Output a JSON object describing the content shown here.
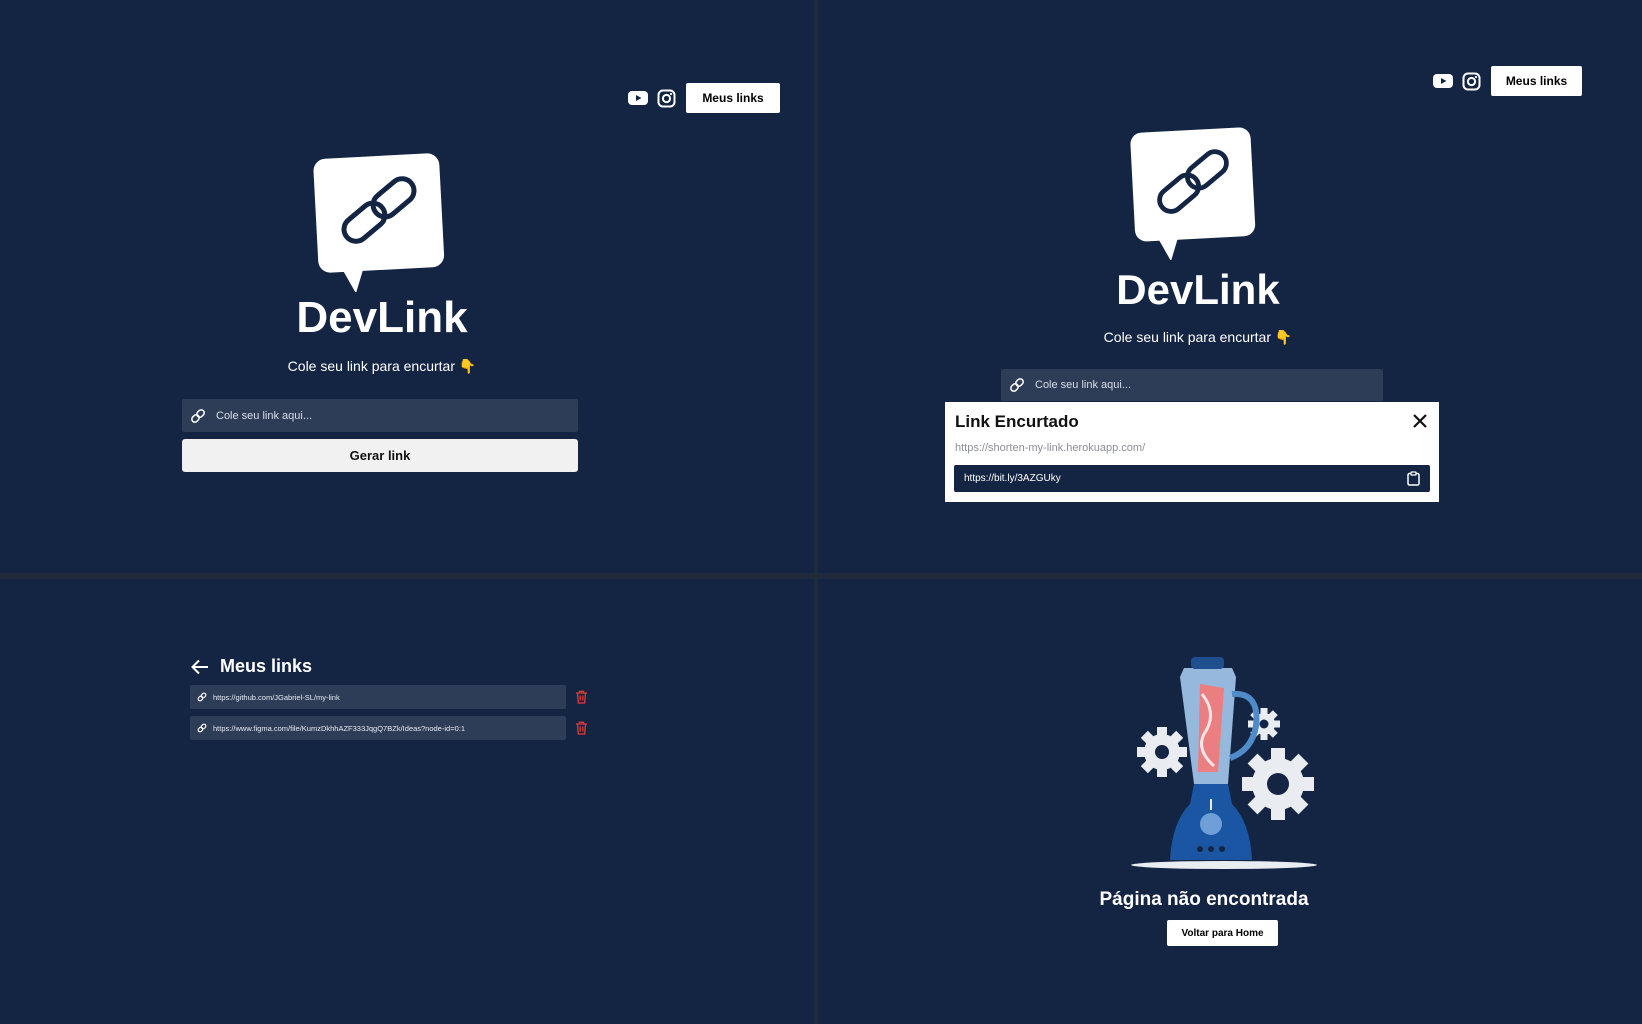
{
  "home": {
    "nav": {
      "youtube_icon": "youtube-icon",
      "instagram_icon": "instagram-icon",
      "my_links_label": "Meus links"
    },
    "brand": "DevLink",
    "subtitle": "Cole seu link para encurtar 👇",
    "input_placeholder": "Cole seu link aqui...",
    "generate_label": "Gerar link"
  },
  "modal_view": {
    "nav": {
      "my_links_label": "Meus links"
    },
    "brand": "DevLink",
    "subtitle": "Cole seu link para encurtar 👇",
    "input_placeholder": "Cole seu link aqui...",
    "modal": {
      "title": "Link Encurtado",
      "original_url": "https://shorten-my-link.herokuapp.com/",
      "short_url": "https://bit.ly/3AZGUky"
    }
  },
  "links_page": {
    "title": "Meus links",
    "items": [
      {
        "url": "https://github.com/JGabriel-SL/my-link"
      },
      {
        "url": "https://www.figma.com/file/KumzDkhhAZF333JqgQ7BZk/Ideas?node-id=0:1"
      }
    ]
  },
  "not_found": {
    "title": "Página não encontrada",
    "button_label": "Voltar para Home"
  },
  "colors": {
    "background": "#142544",
    "input": "#2d3d58",
    "danger": "#e53935",
    "white": "#ffffff"
  }
}
